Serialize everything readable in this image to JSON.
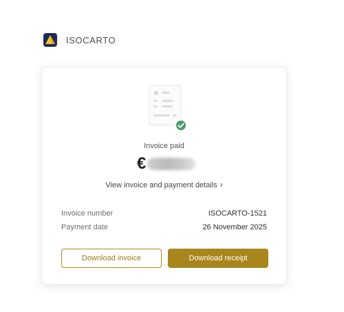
{
  "brand": {
    "name": "ISOCARTO",
    "icon": "isocarto-logo"
  },
  "invoice": {
    "status": "Invoice paid",
    "currency_symbol": "€",
    "amount_hidden": true,
    "details_link": "View invoice and payment details",
    "number_label": "Invoice number",
    "number_value": "ISOCARTO-1521",
    "date_label": "Payment date",
    "date_value": "26 November 2025"
  },
  "actions": {
    "download_invoice": "Download invoice",
    "download_receipt": "Download receipt"
  },
  "colors": {
    "accent": "#a8861c",
    "success": "#4e9a6a"
  }
}
